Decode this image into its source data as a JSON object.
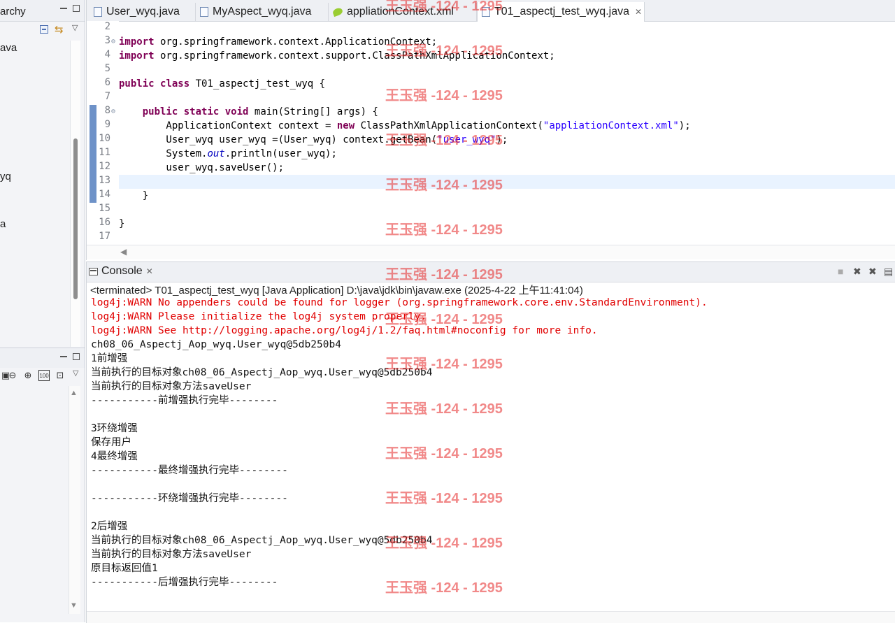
{
  "left_panel": {
    "title": "archy",
    "tree_items": [
      "ava",
      "yq",
      "a"
    ],
    "bottom_tools": [
      "▣",
      "⊖",
      "⊕",
      "100",
      "⊡"
    ]
  },
  "editor": {
    "tabs": [
      {
        "label": "User_wyq.java",
        "icon": "java-file-icon"
      },
      {
        "label": "MyAspect_wyq.java",
        "icon": "java-file-icon"
      },
      {
        "label": "appliationContext.xml",
        "icon": "xml-file-icon"
      },
      {
        "label": "T01_aspectj_test_wyq.java",
        "icon": "java-file-icon",
        "active": true
      }
    ],
    "lines": [
      {
        "num": "2",
        "html": ""
      },
      {
        "num": "3",
        "html": "<span class=\"kw\">import</span> org.springframework.context.ApplicationContext;",
        "fold": true
      },
      {
        "num": "4",
        "html": "<span class=\"kw\">import</span> org.springframework.context.support.ClassPathXmlApplicationContext;"
      },
      {
        "num": "5",
        "html": ""
      },
      {
        "num": "6",
        "html": "<span class=\"kw\">public</span> <span class=\"kw\">class</span> T01_aspectj_test_wyq {"
      },
      {
        "num": "7",
        "html": ""
      },
      {
        "num": "8",
        "html": "    <span class=\"kw\">public</span> <span class=\"kw\">static</span> <span class=\"kw\">void</span> main(String[] args) {",
        "fold": true
      },
      {
        "num": "9",
        "html": "        ApplicationContext context = <span class=\"kw\">new</span> ClassPathXmlApplicationContext(<span class=\"str\">\"appliationContext.xml\"</span>);"
      },
      {
        "num": "10",
        "html": "        User_wyq user_wyq =(User_wyq) context.getBean(<span class=\"str\">\"user_wyq\"</span>);"
      },
      {
        "num": "11",
        "html": "        System.<span class=\"field\">out</span>.println(user_wyq);"
      },
      {
        "num": "12",
        "html": "        user_wyq.saveUser();"
      },
      {
        "num": "13",
        "html": ""
      },
      {
        "num": "14",
        "html": "    }"
      },
      {
        "num": "15",
        "html": ""
      },
      {
        "num": "16",
        "html": "}"
      },
      {
        "num": "17",
        "html": ""
      }
    ]
  },
  "console": {
    "tab_label": "Console",
    "status": "<terminated> T01_aspectj_test_wyq [Java Application] D:\\java\\jdk\\bin\\javaw.exe (2025-4-22 上午11:41:04)",
    "lines": [
      {
        "text": "log4j:WARN No appenders could be found for logger (org.springframework.core.env.StandardEnvironment).",
        "err": true
      },
      {
        "text": "log4j:WARN Please initialize the log4j system properly.",
        "err": true
      },
      {
        "text": "log4j:WARN See http://logging.apache.org/log4j/1.2/faq.html#noconfig for more info.",
        "err": true
      },
      {
        "text": "ch08_06_Aspectj_Aop_wyq.User_wyq@5db250b4"
      },
      {
        "text": "1前增强"
      },
      {
        "text": "当前执行的目标对象ch08_06_Aspectj_Aop_wyq.User_wyq@5db250b4"
      },
      {
        "text": "当前执行的目标对象方法saveUser"
      },
      {
        "text": "-----------前增强执行完毕--------"
      },
      {
        "text": ""
      },
      {
        "text": "3环绕增强"
      },
      {
        "text": "保存用户"
      },
      {
        "text": "4最终增强"
      },
      {
        "text": "-----------最终增强执行完毕--------"
      },
      {
        "text": ""
      },
      {
        "text": "-----------环绕增强执行完毕--------"
      },
      {
        "text": ""
      },
      {
        "text": "2后增强"
      },
      {
        "text": "当前执行的目标对象ch08_06_Aspectj_Aop_wyq.User_wyq@5db250b4"
      },
      {
        "text": "当前执行的目标对象方法saveUser"
      },
      {
        "text": "原目标返回值1"
      },
      {
        "text": "-----------后增强执行完毕--------"
      }
    ]
  },
  "watermark": {
    "text": "王玉强 -124 - 1295"
  }
}
